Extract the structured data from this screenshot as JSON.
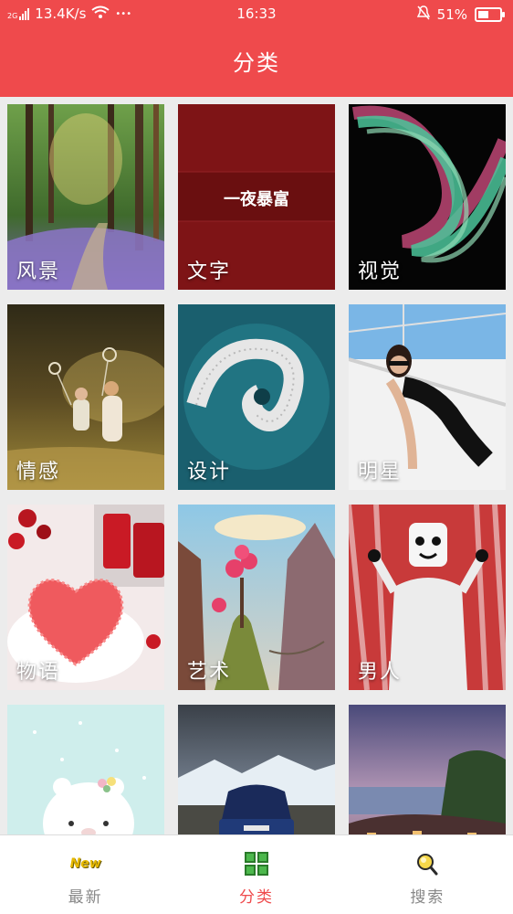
{
  "status_bar": {
    "network_label": "2G",
    "speed": "13.4K/s",
    "more": "•••",
    "time": "16:33",
    "battery_percent": "51%",
    "battery_level": 0.51
  },
  "header": {
    "title": "分类"
  },
  "categories": [
    {
      "label": "风景",
      "art": "forest"
    },
    {
      "label": "文字",
      "art": "calligraphy",
      "inner_text": "一夜暴富"
    },
    {
      "label": "视觉",
      "art": "ribbon"
    },
    {
      "label": "情感",
      "art": "kids"
    },
    {
      "label": "设计",
      "art": "stairs"
    },
    {
      "label": "明星",
      "art": "yacht"
    },
    {
      "label": "物语",
      "art": "cake"
    },
    {
      "label": "艺术",
      "art": "fantasy"
    },
    {
      "label": "男人",
      "art": "marshmello"
    },
    {
      "label": "",
      "art": "bear"
    },
    {
      "label": "",
      "art": "car"
    },
    {
      "label": "",
      "art": "village"
    }
  ],
  "tab_bar": {
    "tabs": [
      {
        "label": "最新",
        "icon": "new-badge-icon",
        "badge_text": "New",
        "active": false
      },
      {
        "label": "分类",
        "icon": "grid-icon",
        "active": true
      },
      {
        "label": "搜索",
        "icon": "search-icon",
        "active": false
      }
    ]
  },
  "colors": {
    "accent": "#ef4a4c",
    "tab_inactive": "#888888"
  }
}
